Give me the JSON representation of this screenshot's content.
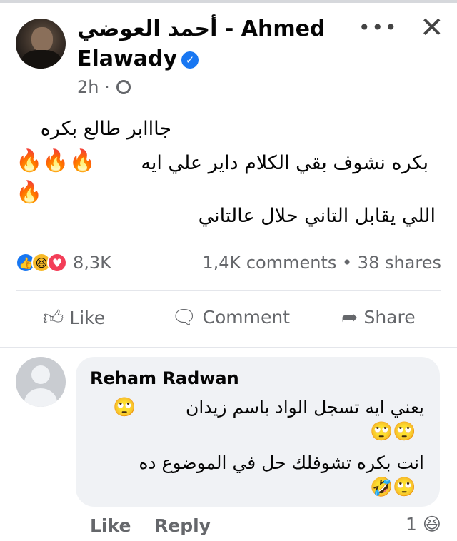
{
  "post": {
    "author": "أحمد العوضي - Ahmed Elawady",
    "time": "2h",
    "line1": "جااابر طالع بكره",
    "line2": "بكره نشوف بقي الكلام داير علي ايه",
    "line3": "اللي يقابل التاني حلال عالتاني",
    "fire_emoji": "🔥🔥🔥🔥"
  },
  "reactions": {
    "count": "8,3K",
    "comments": "1,4K comments",
    "shares": "38 shares"
  },
  "actions": {
    "like": "Like",
    "comment": "Comment",
    "share": "Share"
  },
  "comment": {
    "name": "Reham Radwan",
    "line1": "يعني ايه تسجل الواد باسم زيدان",
    "line2": "انت بكره تشوفلك حل في الموضوع ده",
    "like": "Like",
    "reply": "Reply",
    "reaction_count": "1"
  }
}
